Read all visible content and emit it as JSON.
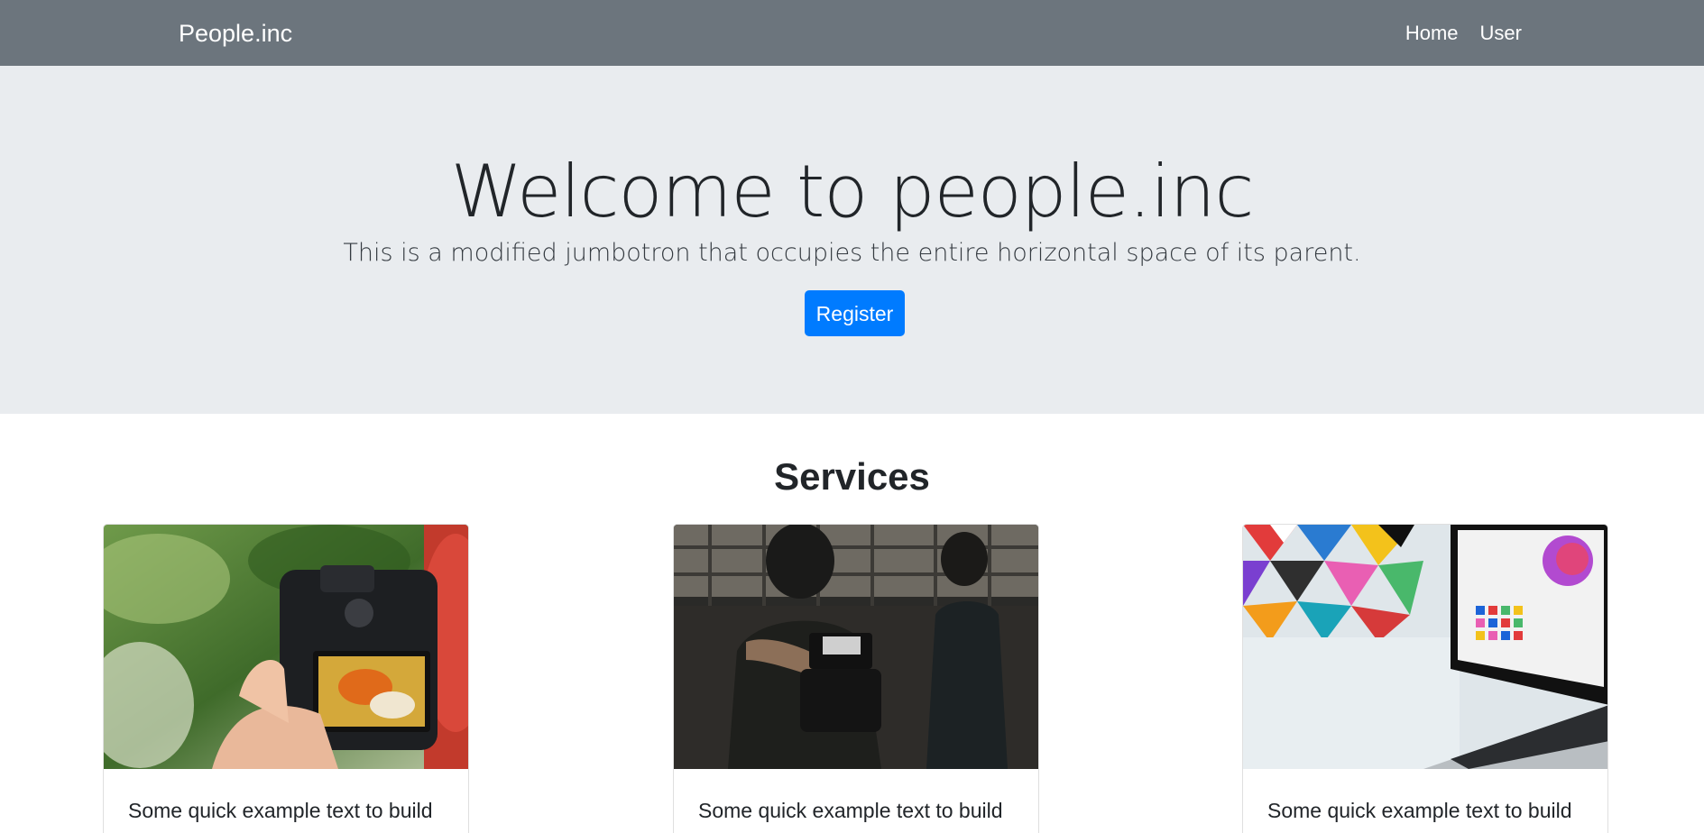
{
  "navbar": {
    "brand": "People.inc",
    "links": [
      {
        "label": "Home"
      },
      {
        "label": "User"
      }
    ]
  },
  "jumbotron": {
    "title": "Welcome to people.inc",
    "lead": "This is a modified jumbotron that occupies the entire horizontal space of its parent.",
    "button_label": "Register"
  },
  "services": {
    "title": "Services",
    "cards": [
      {
        "image": "camera-photo",
        "text": "Some quick example text to build on the card title and make up the"
      },
      {
        "image": "videographers-photo",
        "text": "Some quick example text to build on the card title and make up the"
      },
      {
        "image": "laptop-colorful-photo",
        "text": "Some quick example text to build on the card title and make up the"
      }
    ]
  },
  "colors": {
    "navbar": "#6c757d",
    "jumbotron": "#e9ecef",
    "primary": "#007bff"
  }
}
